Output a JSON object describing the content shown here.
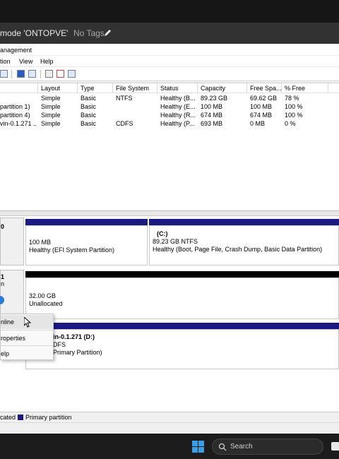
{
  "pve": {
    "title": "mode 'ONTOPVE'",
    "tags": "No Tags"
  },
  "window": {
    "title": "anagement"
  },
  "menu": [
    "tion",
    "View",
    "Help"
  ],
  "table": {
    "columns": [
      "Layout",
      "Type",
      "File System",
      "Status",
      "Capacity",
      "Free Spa...",
      "% Free"
    ],
    "rows": [
      [
        "",
        "Simple",
        "Basic",
        "NTFS",
        "Healthy (B...",
        "89.23 GB",
        "69.62 GB",
        "78 %"
      ],
      [
        "partition 1)",
        "Simple",
        "Basic",
        "",
        "Healthy (E...",
        "100 MB",
        "100 MB",
        "100 %"
      ],
      [
        "partition 4)",
        "Simple",
        "Basic",
        "",
        "Healthy (R...",
        "674 MB",
        "674 MB",
        "100 %"
      ],
      [
        "vin-0.1.271 ...",
        "Simple",
        "Basic",
        "CDFS",
        "Healthy (P...",
        "693 MB",
        "0 MB",
        "0 %"
      ]
    ]
  },
  "disks": {
    "disk0": {
      "label": "0",
      "efi": {
        "size": "100 MB",
        "status": "Healthy (EFI System Partition)"
      },
      "c": {
        "name": "(C:)",
        "size": "89.23 GB NTFS",
        "status": "Healthy (Boot, Page File, Crash Dump, Basic Data Partition)"
      }
    },
    "disk1": {
      "label_a": "1",
      "label_b": "n",
      "unalloc": {
        "size": "32.00 GB",
        "status": "Unallocated"
      }
    },
    "cdrom": {
      "name": "in-0.1.271 (D:)",
      "fs": "DFS",
      "status": "Primary Partition)"
    }
  },
  "context_menu": [
    "nline",
    "roperties",
    "elp"
  ],
  "legend": {
    "unallocated": "cated",
    "primary": "Primary partition"
  },
  "taskbar": {
    "search_placeholder": "Search"
  },
  "colors": {
    "primary": "#1a1a80",
    "unallocated": "#000000",
    "accent": "#2b79d8"
  }
}
